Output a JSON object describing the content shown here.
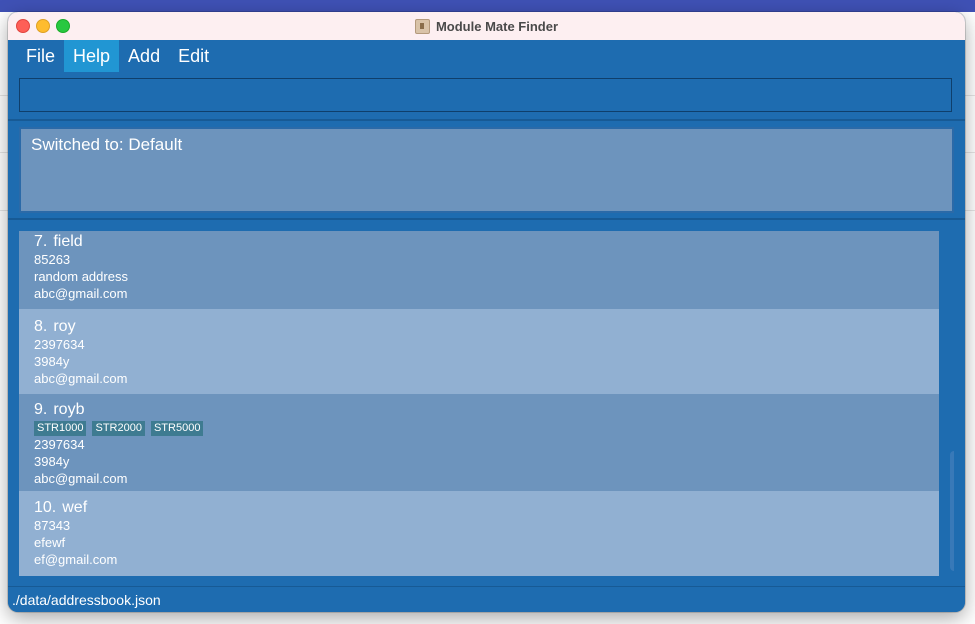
{
  "window": {
    "title": "Module Mate Finder"
  },
  "menu": [
    {
      "label": "File"
    },
    {
      "label": "Help"
    },
    {
      "label": "Add"
    },
    {
      "label": "Edit"
    }
  ],
  "command": {
    "value": "",
    "placeholder": ""
  },
  "result": {
    "text": "Switched to: Default"
  },
  "persons": [
    {
      "index": "7.",
      "name": "field",
      "tags": [],
      "phone": "85263",
      "address": "random address",
      "email": "abc@gmail.com"
    },
    {
      "index": "8.",
      "name": "roy",
      "tags": [],
      "phone": "2397634",
      "address": "3984y",
      "email": "abc@gmail.com"
    },
    {
      "index": "9.",
      "name": "royb",
      "tags": [
        "STR1000",
        "STR2000",
        "STR5000"
      ],
      "phone": "2397634",
      "address": "3984y",
      "email": "abc@gmail.com"
    },
    {
      "index": "10.",
      "name": "wef",
      "tags": [],
      "phone": "87343",
      "address": "efewf",
      "email": "ef@gmail.com"
    }
  ],
  "status": {
    "path": "./data/addressbook.json"
  },
  "colors": {
    "accent": "#1e6cb0",
    "card_dark": "#6d94bd",
    "card_light": "#91b0d2",
    "tag": "#3e7b91",
    "menu_active": "#2196d3"
  }
}
